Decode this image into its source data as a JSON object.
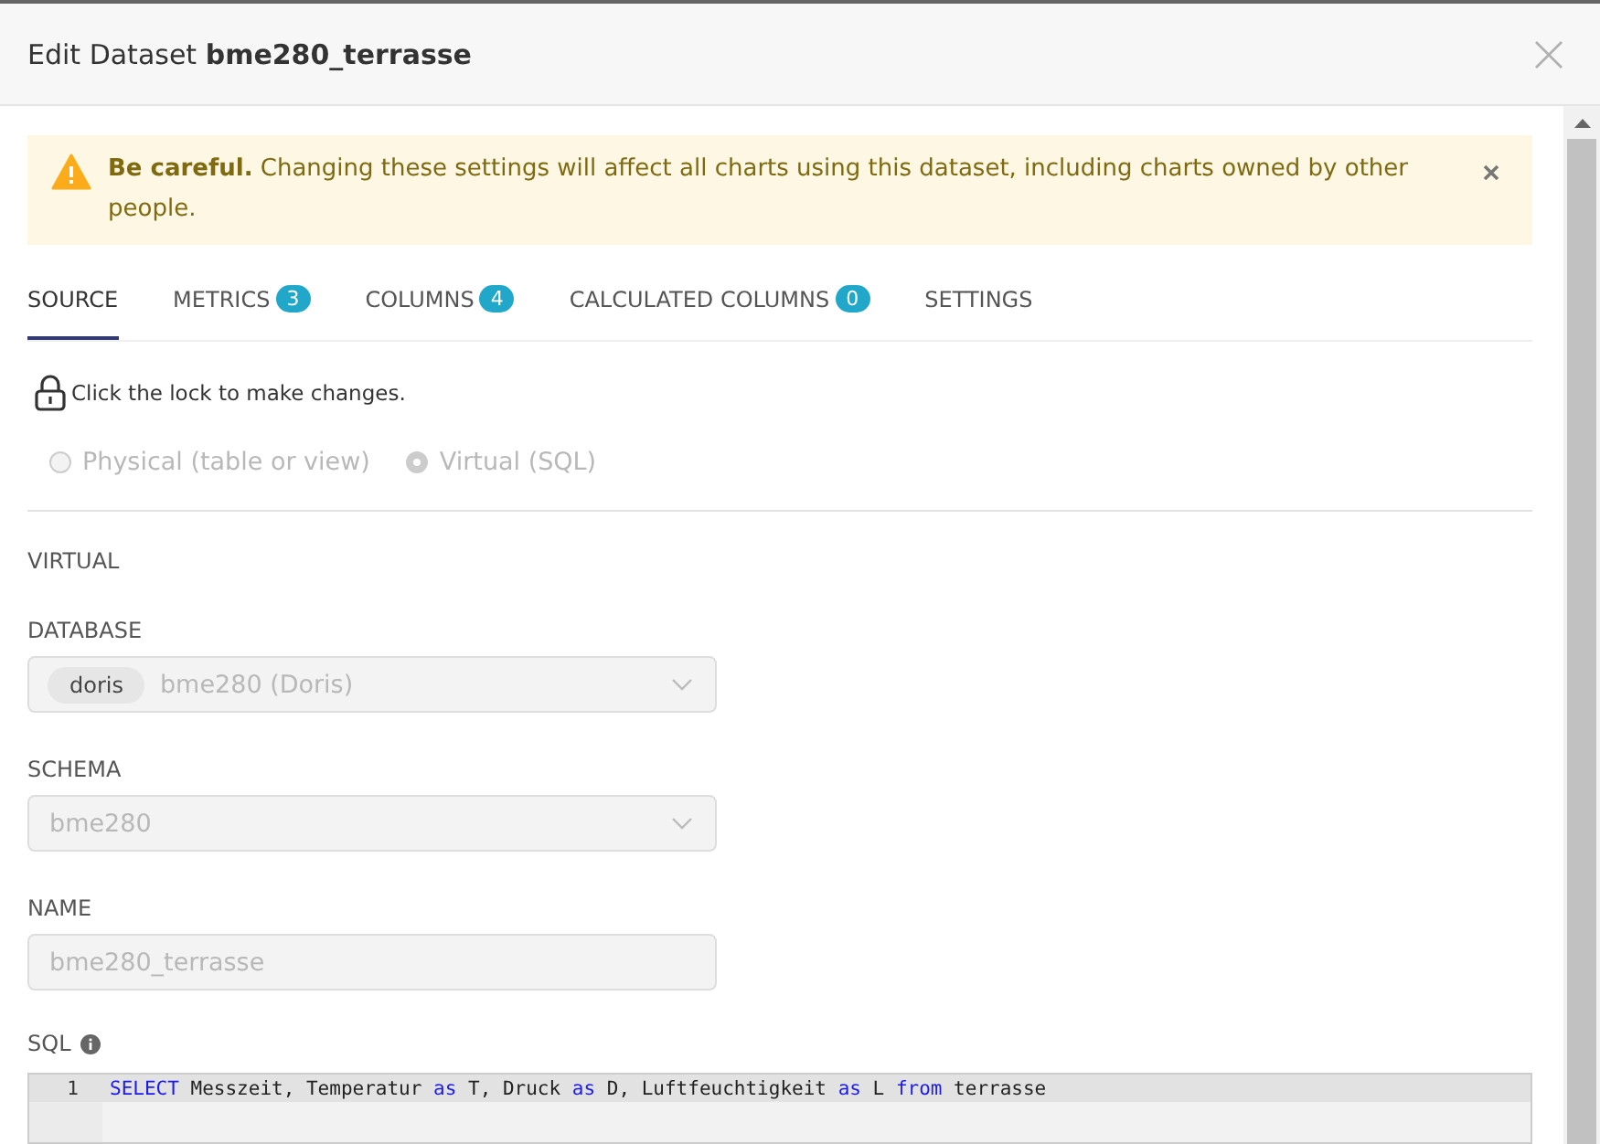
{
  "window": {
    "title_prefix": "Edit Dataset",
    "title_name": "bme280_terrasse"
  },
  "alert": {
    "text": "**Be careful.** Changing these settings will affect all charts using this dataset, including charts owned by other people."
  },
  "tabs": [
    {
      "label": "SOURCE",
      "selected": true
    },
    {
      "label": "METRICS",
      "count": "3",
      "selected": false
    },
    {
      "label": "COLUMNS",
      "count": "4",
      "selected": false
    },
    {
      "label": "CALCULATED COLUMNS",
      "count": "0",
      "selected": false
    },
    {
      "label": "SETTINGS",
      "selected": false
    }
  ],
  "lock_hint": "Click the lock to make changes.",
  "source_types": [
    {
      "label": "Physical (table or view)",
      "checked": false
    },
    {
      "label": "Virtual (SQL)",
      "checked": true
    }
  ],
  "section_title": "VIRTUAL",
  "database": {
    "label": "DATABASE",
    "tag": "doris",
    "value": "bme280 (Doris)"
  },
  "schema": {
    "label": "SCHEMA",
    "value": "bme280"
  },
  "name": {
    "label": "NAME",
    "value": "bme280_terrasse"
  },
  "sql": {
    "label": "SQL",
    "lines": [
      {
        "number": "1",
        "tokens": [
          {
            "kind": "keyword",
            "text": "SELECT"
          },
          {
            "kind": "plain",
            "text": " Messzeit, Temperatur "
          },
          {
            "kind": "keyword",
            "text": "as"
          },
          {
            "kind": "plain",
            "text": " T, Druck "
          },
          {
            "kind": "keyword",
            "text": "as"
          },
          {
            "kind": "plain",
            "text": " D, Luftfeuchtigkeit "
          },
          {
            "kind": "keyword",
            "text": "as"
          },
          {
            "kind": "plain",
            "text": " L "
          },
          {
            "kind": "keyword",
            "text": "from"
          },
          {
            "kind": "plain",
            "text": " terrasse"
          }
        ]
      }
    ]
  }
}
